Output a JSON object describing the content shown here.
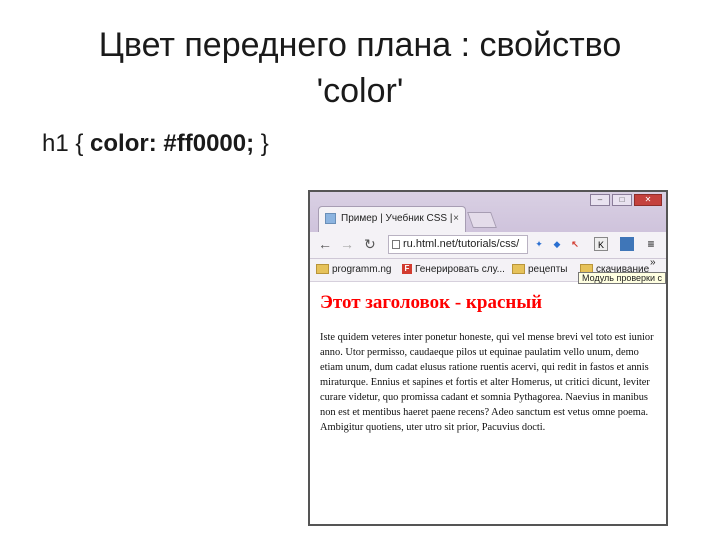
{
  "slide": {
    "title_line1": "Цвет переднего плана : свойство",
    "title_line2": "'color'",
    "code_prefix": "h1 { ",
    "code_bold": "color: #ff0000;",
    "code_suffix": " }"
  },
  "browser": {
    "tab_title": "Пример | Учебник CSS |",
    "tab_close": "×",
    "address": "ru.html.net/tutorials/css/",
    "bookmarks": [
      {
        "label": "programm.ng"
      },
      {
        "label": "Генерировать слу..."
      },
      {
        "label": "рецепты"
      },
      {
        "label": "скачивание"
      }
    ],
    "overflow_chevron": "»",
    "tooltip": "Модуль проверки с",
    "ext_labels": [
      "K"
    ],
    "heading": "Этот заголовок - красный",
    "paragraph": "Iste quidem veteres inter ponetur honeste, qui vel mense brevi vel toto est iunior anno. Utor permisso, caudaeque pilos ut equinae paulatim vello unum, demo etiam unum, dum cadat elusus ratione ruentis acervi, qui redit in fastos et annis miraturque. Ennius et sapines et fortis et alter Homerus, ut critici dicunt, leviter curare videtur, quo promissa cadant et somnia Pythagorea. Naevius in manibus non est et mentibus haeret paene recens? Adeo sanctum est vetus omne poema. Ambigitur quotiens, uter utro sit prior, Pacuvius docti."
  },
  "colors": {
    "heading_red": "#ff0000",
    "titlebar": "#d9d0e3"
  }
}
